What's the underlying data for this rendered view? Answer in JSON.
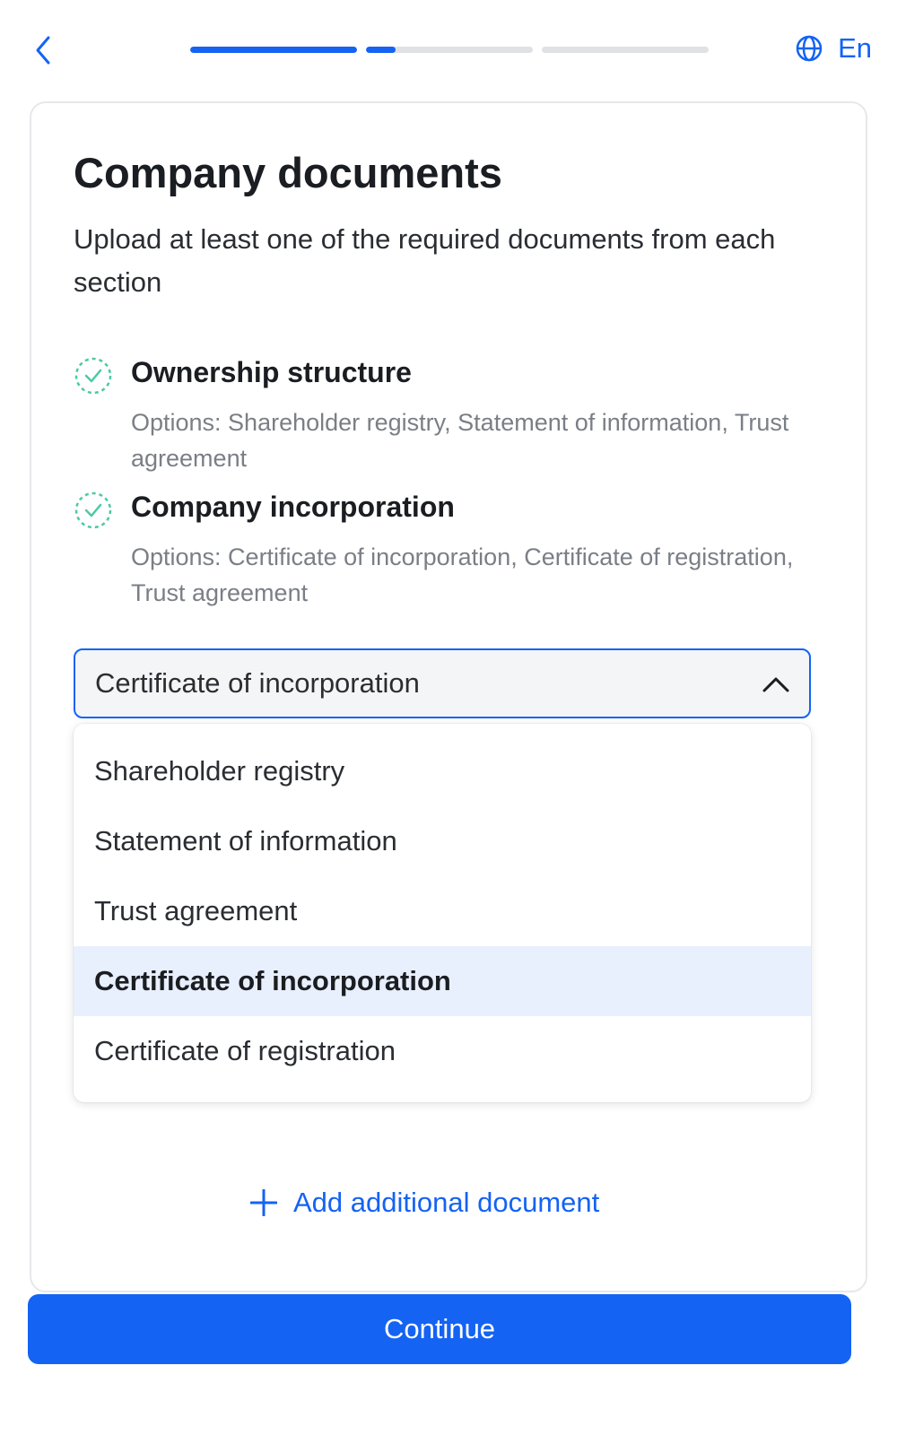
{
  "header": {
    "back_icon": "chevron-left-icon",
    "progress": [
      1.0,
      0.18,
      0.0,
      0.0
    ],
    "language_icon": "globe-icon",
    "language_label": "En"
  },
  "page": {
    "title": "Company documents",
    "subtitle": "Upload at least one of the required documents from each section"
  },
  "requirements": [
    {
      "icon": "dashed-check-circle-icon",
      "title": "Ownership structure",
      "options": "Options: Shareholder registry, Statement of information, Trust agreement"
    },
    {
      "icon": "dashed-check-circle-icon",
      "title": "Company incorporation",
      "options": "Options: Certificate of incorporation, Certificate of registration, Trust agreement"
    }
  ],
  "document_select": {
    "value": "Certificate of incorporation",
    "chevron_icon": "chevron-up-icon",
    "options": [
      "Shareholder registry",
      "Statement of information",
      "Trust agreement",
      "Certificate of incorporation",
      "Certificate of registration"
    ],
    "selected_option": "Certificate of incorporation"
  },
  "add_document": {
    "icon": "plus-icon",
    "label": "Add additional document"
  },
  "footer": {
    "continue_label": "Continue"
  },
  "colors": {
    "accent": "#1463f3",
    "success": "#4cc9a4",
    "muted_text": "#7a7f86",
    "selected_bg": "#e8effd"
  }
}
